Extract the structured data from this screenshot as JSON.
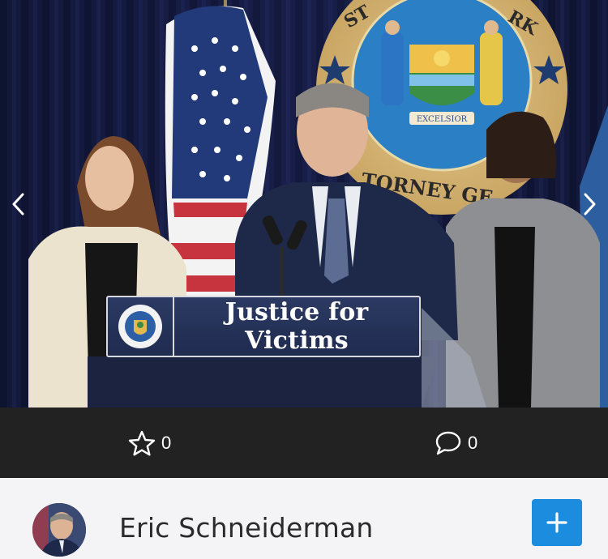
{
  "photo": {
    "podium_text": "Justice for Victims",
    "nav": {
      "prev_icon": "chevron-left-icon",
      "next_icon": "chevron-right-icon"
    }
  },
  "actions": {
    "star": {
      "icon": "star-icon",
      "count": "0"
    },
    "comment": {
      "icon": "comment-icon",
      "count": "0"
    }
  },
  "author": {
    "name": "Eric Schneiderman",
    "add_icon": "plus-icon"
  },
  "colors": {
    "action_bar_bg": "#222222",
    "author_row_bg": "#f4f4f6",
    "add_button": "#1b8cde",
    "podium_sign": "#1f2b4f"
  }
}
